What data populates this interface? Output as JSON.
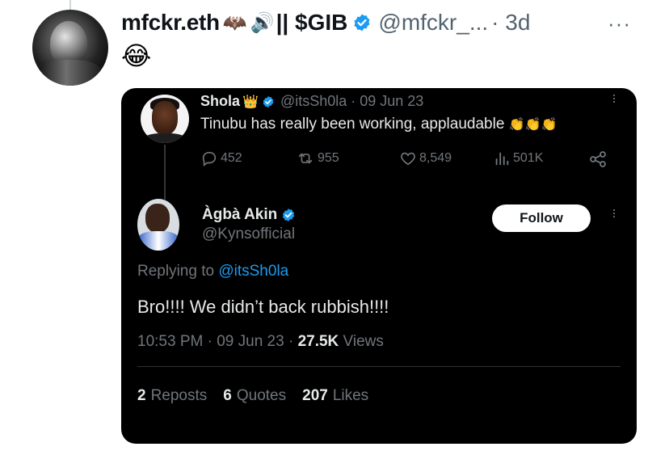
{
  "author": {
    "display_name": "mfckr.eth",
    "emoji_bat": "🦇",
    "emoji_speaker": "🔊",
    "separator_gib": "|| $GIB",
    "handle": "@mfckr_...",
    "timestamp": "· 3d",
    "more": "···"
  },
  "tweet": {
    "text_emoji": "😂"
  },
  "quoted": {
    "name": "Shola",
    "crown": "👑",
    "handle": "@itsSh0la · 09 Jun 23",
    "text": "Tinubu has really been working, applaudable",
    "claps": "👏👏👏",
    "stats": {
      "replies": "452",
      "reposts": "955",
      "likes": "8,549",
      "views": "501K"
    },
    "more": "···"
  },
  "reply": {
    "name": "Àgbà Akin",
    "handle": "@Kynsofficial",
    "follow_label": "Follow",
    "replying_prefix": "Replying to",
    "replying_to": "@itsSh0la",
    "text": "Bro!!!! We didn’t back rubbish!!!!",
    "time_date": "10:53 PM · 09 Jun 23 ·",
    "views_count": "27.5K",
    "views_label": "Views",
    "reposts_count": "2",
    "reposts_label": "Reposts",
    "quotes_count": "6",
    "quotes_label": "Quotes",
    "likes_count": "207",
    "likes_label": "Likes",
    "more": "···"
  },
  "colors": {
    "verified_blue": "#1d9bf0",
    "card_bg": "#000000",
    "secondary_text": "#71767b"
  }
}
